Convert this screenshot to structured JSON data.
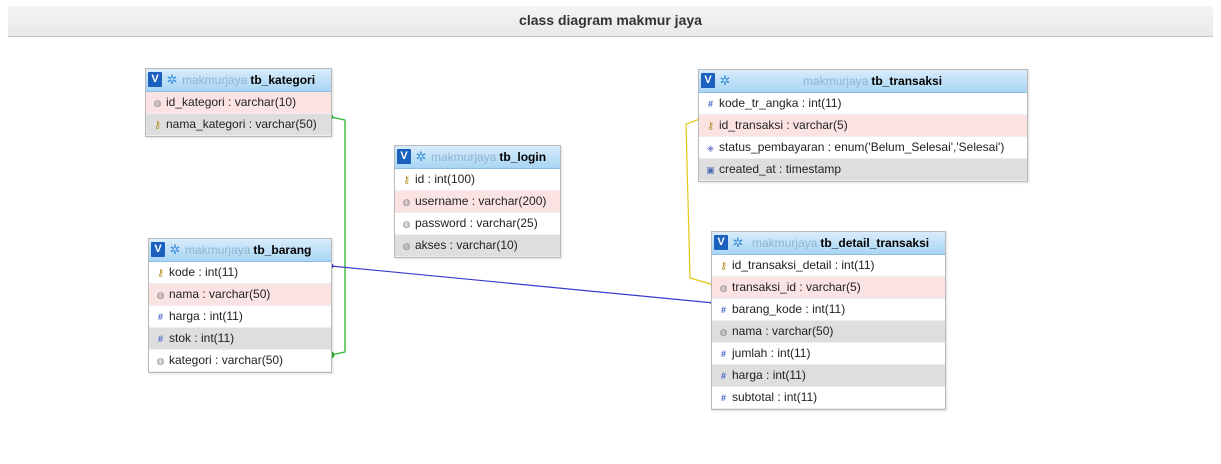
{
  "title": "class diagram makmur jaya",
  "db_name": "makmurjaya",
  "colors": {
    "header_start": "#d8ecfb",
    "header_end": "#a8d5f4",
    "pk_row": "#fbe3e3",
    "grey_row": "#dedede",
    "rel_green": "#2db52d",
    "rel_blue": "#3b3bcc",
    "rel_yellow": "#e6c619"
  },
  "tables": {
    "tb_kategori": {
      "name": "tb_kategori",
      "fields": [
        {
          "label": "id_kategori : varchar(10)",
          "icon": "field-icon"
        },
        {
          "label": "nama_kategori : varchar(50)",
          "icon": "key-icon"
        }
      ]
    },
    "tb_login": {
      "name": "tb_login",
      "fields": [
        {
          "label": "id : int(100)",
          "icon": "key-icon"
        },
        {
          "label": "username : varchar(200)",
          "icon": "field-icon"
        },
        {
          "label": "password : varchar(25)",
          "icon": "field-icon"
        },
        {
          "label": "akses : varchar(10)",
          "icon": "field-icon"
        }
      ]
    },
    "tb_barang": {
      "name": "tb_barang",
      "fields": [
        {
          "label": "kode : int(11)",
          "icon": "key-icon"
        },
        {
          "label": "nama : varchar(50)",
          "icon": "field-icon"
        },
        {
          "label": "harga : int(11)",
          "icon": "number-icon"
        },
        {
          "label": "stok : int(11)",
          "icon": "number-icon"
        },
        {
          "label": "kategori : varchar(50)",
          "icon": "field-icon"
        }
      ]
    },
    "tb_transaksi": {
      "name": "tb_transaksi",
      "fields": [
        {
          "label": "kode_tr_angka : int(11)",
          "icon": "number-icon"
        },
        {
          "label": "id_transaksi : varchar(5)",
          "icon": "key-icon"
        },
        {
          "label": "status_pembayaran : enum('Belum_Selesai','Selesai')",
          "icon": "enum-icon"
        },
        {
          "label": "created_at : timestamp",
          "icon": "timestamp-icon"
        }
      ]
    },
    "tb_detail_transaksi": {
      "name": "tb_detail_transaksi",
      "fields": [
        {
          "label": "id_transaksi_detail : int(11)",
          "icon": "key-icon"
        },
        {
          "label": "transaksi_id : varchar(5)",
          "icon": "field-icon"
        },
        {
          "label": "barang_kode : int(11)",
          "icon": "number-icon"
        },
        {
          "label": "nama : varchar(50)",
          "icon": "field-icon"
        },
        {
          "label": "jumlah : int(11)",
          "icon": "number-icon"
        },
        {
          "label": "harga : int(11)",
          "icon": "number-icon"
        },
        {
          "label": "subtotal : int(11)",
          "icon": "number-icon"
        }
      ]
    }
  }
}
